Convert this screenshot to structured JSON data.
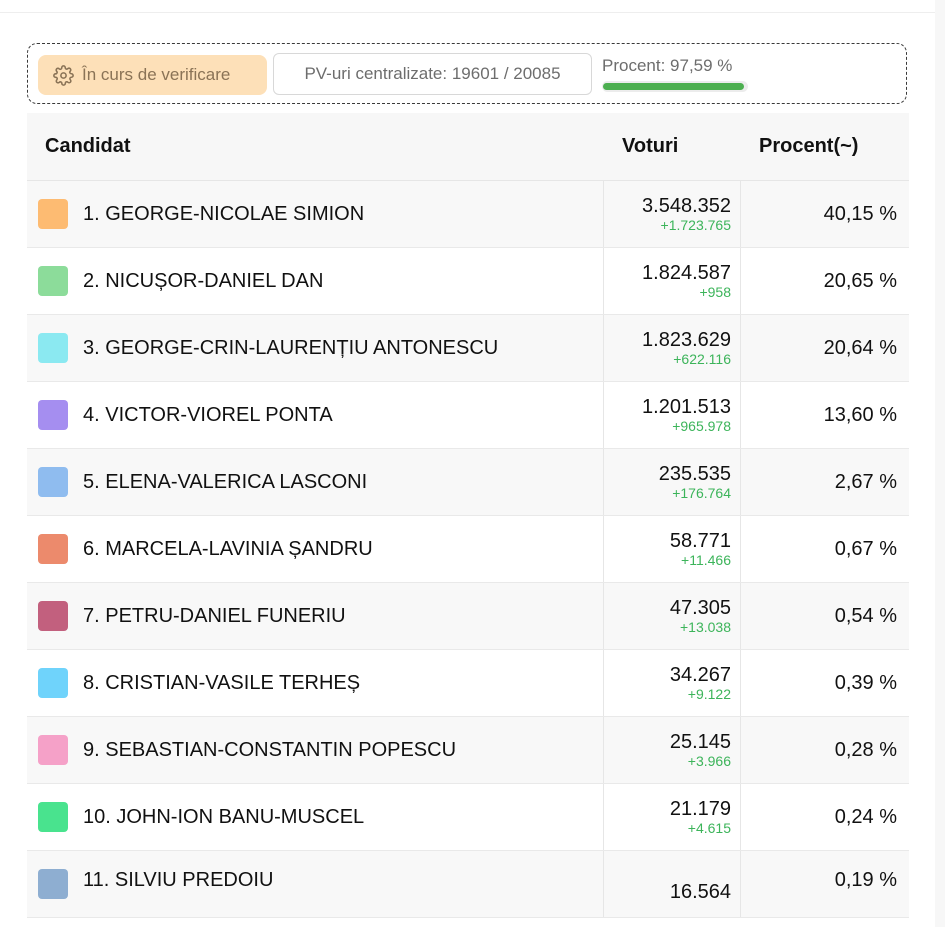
{
  "status": {
    "label": "În curs de verificare",
    "pv_text": "PV-uri centralizate: 19601 / 20085",
    "percent_text": "Procent: 97,59 %",
    "percent_value": 97.59
  },
  "table": {
    "headers": {
      "candidate": "Candidat",
      "votes": "Voturi",
      "percent": "Procent(~)"
    },
    "rows": [
      {
        "name": "1. GEORGE-NICOLAE SIMION",
        "votes": "3.548.352",
        "delta": "+1.723.765",
        "percent": "40,15 %",
        "color": "#fdbb72"
      },
      {
        "name": "2. NICUȘOR-DANIEL DAN",
        "votes": "1.824.587",
        "delta": "+958",
        "percent": "20,65 %",
        "color": "#8cdc9a"
      },
      {
        "name": "3. GEORGE-CRIN-LAURENȚIU ANTONESCU",
        "votes": "1.823.629",
        "delta": "+622.116",
        "percent": "20,64 %",
        "color": "#8be9f1"
      },
      {
        "name": "4. VICTOR-VIOREL PONTA",
        "votes": "1.201.513",
        "delta": "+965.978",
        "percent": "13,60 %",
        "color": "#a58ef0"
      },
      {
        "name": "5. ELENA-VALERICA LASCONI",
        "votes": "235.535",
        "delta": "+176.764",
        "percent": "2,67 %",
        "color": "#8fbcef"
      },
      {
        "name": "6. MARCELA-LAVINIA ȘANDRU",
        "votes": "58.771",
        "delta": "+11.466",
        "percent": "0,67 %",
        "color": "#ec8a6c"
      },
      {
        "name": "7. PETRU-DANIEL FUNERIU",
        "votes": "47.305",
        "delta": "+13.038",
        "percent": "0,54 %",
        "color": "#c2607e"
      },
      {
        "name": "8. CRISTIAN-VASILE TERHEȘ",
        "votes": "34.267",
        "delta": "+9.122",
        "percent": "0,39 %",
        "color": "#6fd3fb"
      },
      {
        "name": "9. SEBASTIAN-CONSTANTIN POPESCU",
        "votes": "25.145",
        "delta": "+3.966",
        "percent": "0,28 %",
        "color": "#f5a1c8"
      },
      {
        "name": "10. JOHN-ION BANU-MUSCEL",
        "votes": "21.179",
        "delta": "+4.615",
        "percent": "0,24 %",
        "color": "#49e38e"
      },
      {
        "name": "11. SILVIU PREDOIU",
        "votes": "16.564",
        "delta": "",
        "percent": "0,19 %",
        "color": "#8eaed1"
      }
    ]
  },
  "icons": {
    "status": "gear-icon"
  }
}
